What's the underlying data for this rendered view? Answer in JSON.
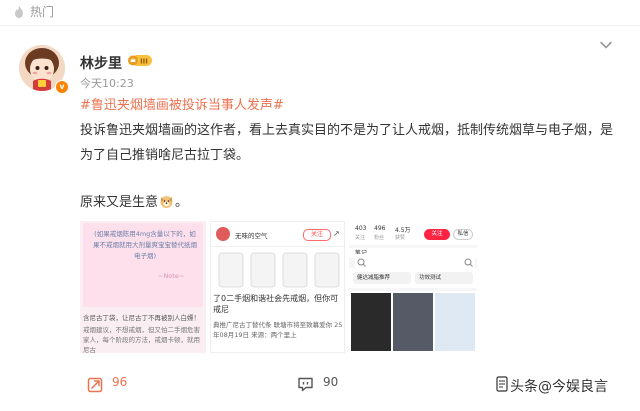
{
  "header": {
    "hot_label": "热门"
  },
  "post": {
    "username": "林步里",
    "vip_badge": "III",
    "verified_mark": "v",
    "timestamp": "今天10:23",
    "hashtag": "#鲁迅夹烟墙画被投诉当事人发声#",
    "content": "投诉鲁迅夹烟墙画的这作者，看上去真实目的不是为了让人戒烟，抵制传统烟草与电子烟，是为了自己推销啥尼古拉丁袋。",
    "content_line2_before": "原来又是生意",
    "content_line2_after": "。",
    "emoji_name": "dog-emoji"
  },
  "images": {
    "img1": {
      "note": "(如果戒烟陈用4mg含量以下的，如果不戒烟就用大剂量爽宝宝替代纸烟电子烟)",
      "note_sig": "~Note~",
      "caption": "含尼古丁袋，让尼古丁不再被别人白嫖！",
      "subcaption": "戒烟建议，不想戒烟，但又怕二手烟危害家人，每个阶段的方法，戒烟卡顿，就用尼古"
    },
    "img2": {
      "account": "无味的空气",
      "follow": "关注",
      "title": "了0二手烟和谐社会先戒烟，但你可戒尼",
      "sub": "典推广尼古丁替代条 联塘市将至致幕爱你 25年08月19日 来源：两个里上"
    },
    "img3": {
      "stats": [
        {
          "num": "403",
          "label": "关注"
        },
        {
          "num": "496",
          "label": "粉丝"
        },
        {
          "num": "4.5万",
          "label": "获赞"
        }
      ],
      "follow": "关注",
      "msg": "私信",
      "tab": "笔记",
      "card1": "健达减脂推荐",
      "card2": "功效测试"
    }
  },
  "actions": {
    "share_count": "96",
    "comment_count": "90",
    "watermark": "头条@今娱良言"
  },
  "colors": {
    "accent": "#eb7350",
    "verified": "#ff8200",
    "text": "#333333",
    "muted": "#999999"
  }
}
